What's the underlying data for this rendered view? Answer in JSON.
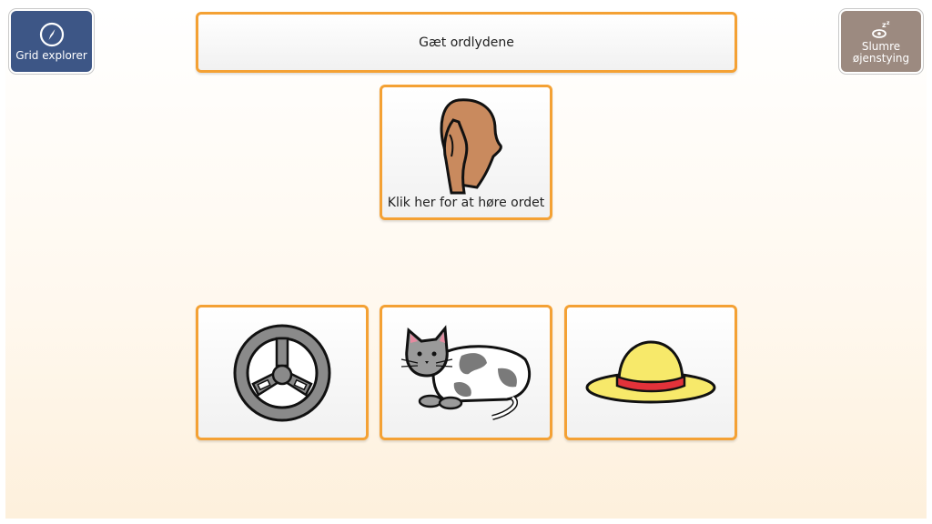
{
  "nav": {
    "grid_explorer_label": "Grid explorer",
    "snooze_label_line1": "Slumre",
    "snooze_label_line2": "øjenstying"
  },
  "title": "Gæt ordlydene",
  "listen": {
    "label": "Klik her for at høre ordet",
    "icon": "ear-listening-icon"
  },
  "choices": [
    {
      "icon": "steering-wheel-icon"
    },
    {
      "icon": "cat-icon"
    },
    {
      "icon": "sun-hat-icon"
    }
  ],
  "colors": {
    "cell_border": "#f4a134",
    "grid_explorer_bg": "#3d5686",
    "snooze_bg": "#9c8a80"
  }
}
